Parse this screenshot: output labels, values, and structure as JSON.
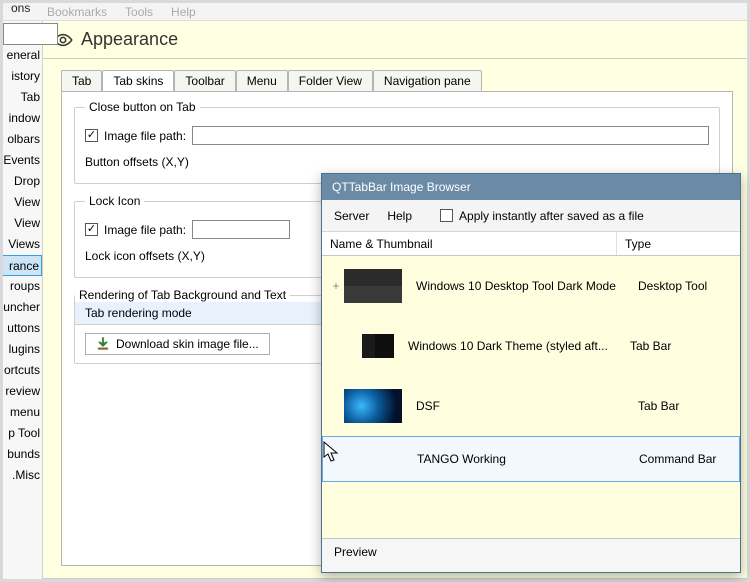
{
  "topmenu": {
    "tail": "ons",
    "m2": "Bookmarks",
    "m3": "Tools",
    "m4": "Help"
  },
  "sidebar": {
    "items": [
      "eneral",
      "istory",
      "Tab",
      "indow",
      "olbars",
      "Events",
      "Drop",
      "View",
      "View",
      "Views",
      "rance",
      "roups",
      "uncher",
      "uttons",
      "lugins",
      "ortcuts",
      "review",
      "menu",
      "p Tool",
      "bunds",
      "Misc."
    ],
    "selectedIndex": 10
  },
  "header": {
    "title": "Appearance"
  },
  "tabs": {
    "items": [
      "Tab",
      "Tab skins",
      "Toolbar",
      "Menu",
      "Folder View",
      "Navigation pane"
    ],
    "activeIndex": 1
  },
  "closebox": {
    "legend": "Close button on Tab",
    "imgpath_label": "Image file path:",
    "imgpath_checked": true,
    "offsets_label": "Button offsets (X,Y)"
  },
  "lockbox": {
    "legend": "Lock Icon",
    "imgpath_label": "Image file path:",
    "imgpath_checked": true,
    "offsets_label": "Lock icon offsets (X,Y)"
  },
  "renderbox": {
    "legend": "Rendering of Tab Background and Text",
    "subhead": "Tab rendering mode",
    "download_label": "Download skin image file..."
  },
  "overlay": {
    "title": "QTTabBar Image Browser",
    "menu": {
      "server": "Server",
      "help": "Help",
      "apply_label": "Apply instantly after saved as a file"
    },
    "columns": {
      "name": "Name & Thumbnail",
      "type": "Type"
    },
    "rows": [
      {
        "label": "Windows 10 Desktop Tool Dark Mode",
        "type": "Desktop Tool",
        "thumb": "dark1",
        "plus": true
      },
      {
        "label": "Windows 10 Dark Theme (styled aft...",
        "type": "Tab Bar",
        "thumb": "dark2",
        "plus": false
      },
      {
        "label": "DSF",
        "type": "Tab Bar",
        "thumb": "dsf",
        "plus": false
      },
      {
        "label": "TANGO Working",
        "type": "Command Bar",
        "thumb": "",
        "plus": false,
        "selected": true
      }
    ],
    "preview": "Preview"
  }
}
